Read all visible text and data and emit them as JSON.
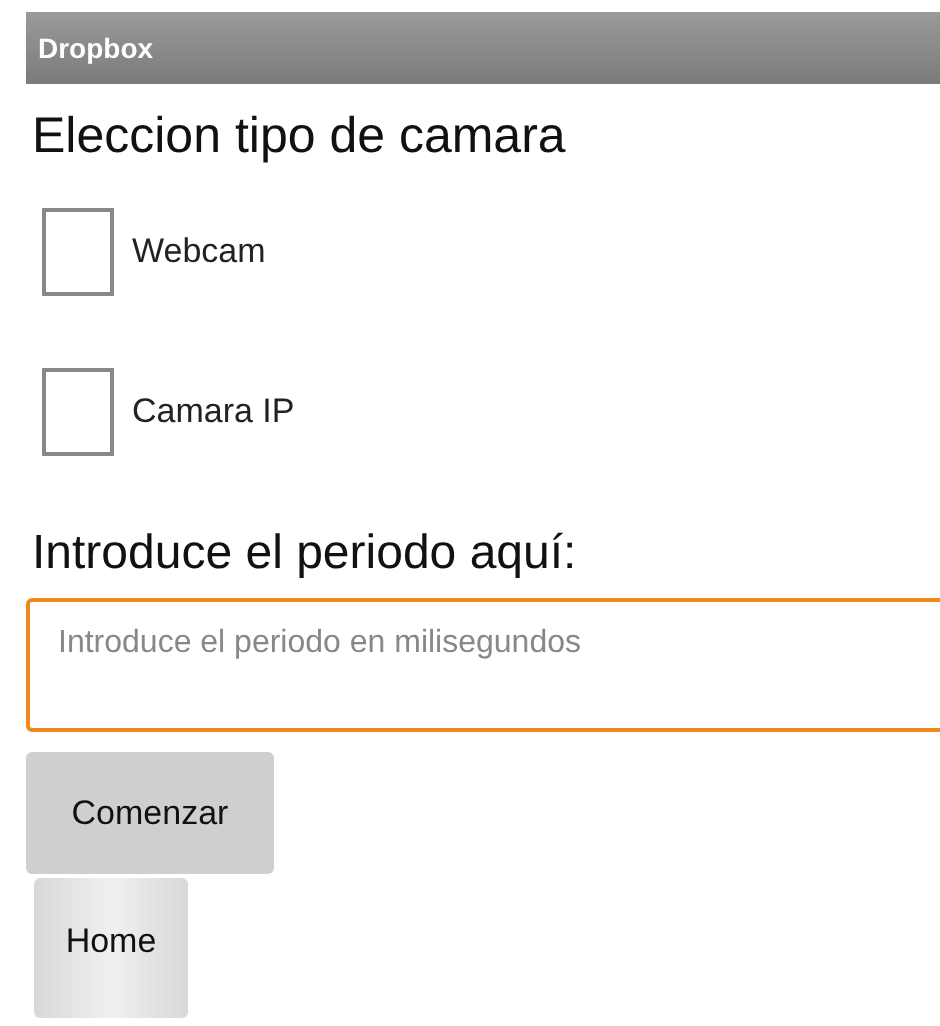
{
  "window": {
    "title": "Dropbox"
  },
  "heading": "Eleccion tipo de camara",
  "options": [
    {
      "label": "Webcam",
      "checked": false
    },
    {
      "label": "Camara IP",
      "checked": false
    }
  ],
  "period_label": "Introduce el periodo aquí:",
  "period_field": {
    "placeholder": "Introduce el periodo en milisegundos",
    "focused": true
  },
  "buttons": [
    {
      "label": "Comenzar",
      "kind": "flat"
    },
    {
      "label": "Home",
      "kind": "raised"
    }
  ]
}
